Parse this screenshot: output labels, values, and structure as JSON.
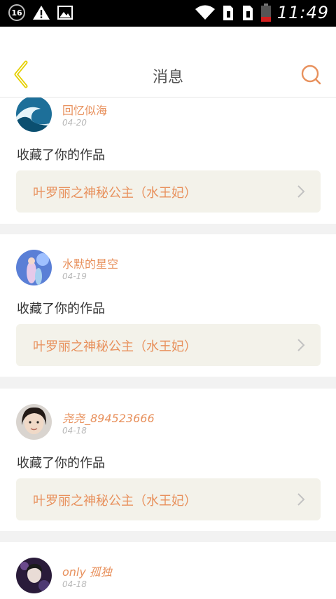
{
  "status_bar": {
    "notification_count": "16",
    "time": "11:49",
    "icons": [
      "notification-badge-icon",
      "warning-icon",
      "image-icon",
      "wifi-icon",
      "sim1-signal-icon",
      "sim2-signal-icon",
      "battery-icon"
    ]
  },
  "header": {
    "title": "消息",
    "back_icon": "chevron-left-icon",
    "search_icon": "search-icon"
  },
  "colors": {
    "accent": "#e8915d",
    "back": "#e6d000",
    "card_bg": "#ffffff",
    "work_bg": "#f3f2ea",
    "page_bg": "#f2f2f2"
  },
  "messages": [
    {
      "username": "回忆似海",
      "date": "04-20",
      "action": "收藏了你的作品",
      "work_title": "叶罗丽之神秘公主（水王妃）",
      "avatar": "wave-avatar"
    },
    {
      "username": "水默的星空",
      "date": "04-19",
      "action": "收藏了你的作品",
      "work_title": "叶罗丽之神秘公主（水王妃）",
      "avatar": "anime-avatar"
    },
    {
      "username": "尧尧_894523666",
      "date": "04-18",
      "action": "收藏了你的作品",
      "work_title": "叶罗丽之神秘公主（水王妃）",
      "avatar": "photo-avatar"
    },
    {
      "username": "only 孤独",
      "date": "04-18",
      "action": "",
      "work_title": "",
      "avatar": "dark-avatar"
    }
  ]
}
